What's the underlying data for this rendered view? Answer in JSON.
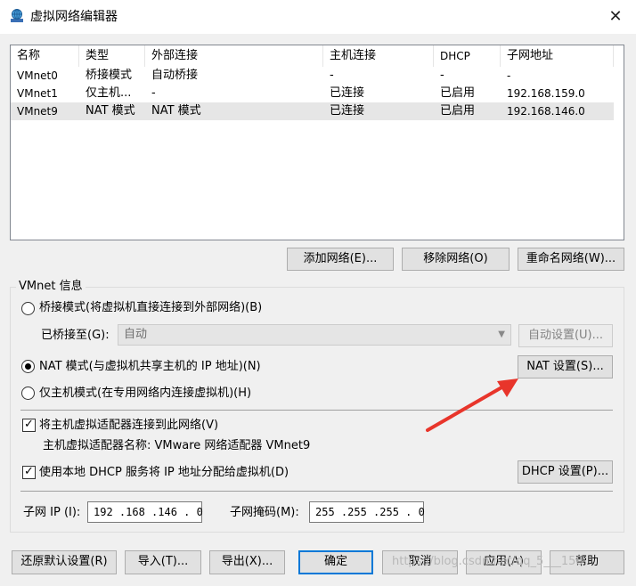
{
  "window": {
    "title": "虚拟网络编辑器",
    "icon": "network-globe-icon",
    "close_glyph": "✕"
  },
  "table": {
    "columns": [
      "名称",
      "类型",
      "外部连接",
      "主机连接",
      "DHCP",
      "子网地址"
    ],
    "rows": [
      {
        "name": "VMnet0",
        "type": "桥接模式",
        "external": "自动桥接",
        "host": "-",
        "dhcp": "-",
        "subnet": "-"
      },
      {
        "name": "VMnet1",
        "type": "仅主机...",
        "external": "-",
        "host": "已连接",
        "dhcp": "已启用",
        "subnet": "192.168.159.0"
      },
      {
        "name": "VMnet9",
        "type": "NAT 模式",
        "external": "NAT 模式",
        "host": "已连接",
        "dhcp": "已启用",
        "subnet": "192.168.146.0"
      }
    ],
    "selected_row": 2
  },
  "network_buttons": {
    "add": "添加网络(E)...",
    "remove": "移除网络(O)",
    "rename": "重命名网络(W)..."
  },
  "vmnet_info": {
    "group_title": "VMnet 信息",
    "bridged_label": "桥接模式(将虚拟机直接连接到外部网络)(B)",
    "bridged_to_label": "已桥接至(G):",
    "bridged_to_value": "自动",
    "auto_settings": "自动设置(U)...",
    "nat_label": "NAT 模式(与虚拟机共享主机的 IP 地址)(N)",
    "nat_settings": "NAT 设置(S)...",
    "hostonly_label": "仅主机模式(在专用网络内连接虚拟机)(H)",
    "selected_mode": "nat",
    "connect_adapter_label": "将主机虚拟适配器连接到此网络(V)",
    "connect_adapter_checked": true,
    "adapter_name_text": "主机虚拟适配器名称: VMware 网络适配器 VMnet9",
    "dhcp_label": "使用本地 DHCP 服务将 IP 地址分配给虚拟机(D)",
    "dhcp_checked": true,
    "dhcp_settings": "DHCP 设置(P)...",
    "subnet_ip_label": "子网 IP (I):",
    "subnet_ip_value": "192 .168 .146 . 0",
    "subnet_mask_label": "子网掩码(M):",
    "subnet_mask_value": "255 .255 .255 . 0"
  },
  "footer_buttons": {
    "restore": "还原默认设置(R)",
    "import": "导入(T)...",
    "export": "导出(X)...",
    "ok": "确定",
    "cancel": "取消",
    "apply": "应用(A)",
    "help": "帮助"
  },
  "annotation": {
    "arrow_color": "#e8352b"
  },
  "watermark": "https://blog.csdn.net/qq_5___158"
}
